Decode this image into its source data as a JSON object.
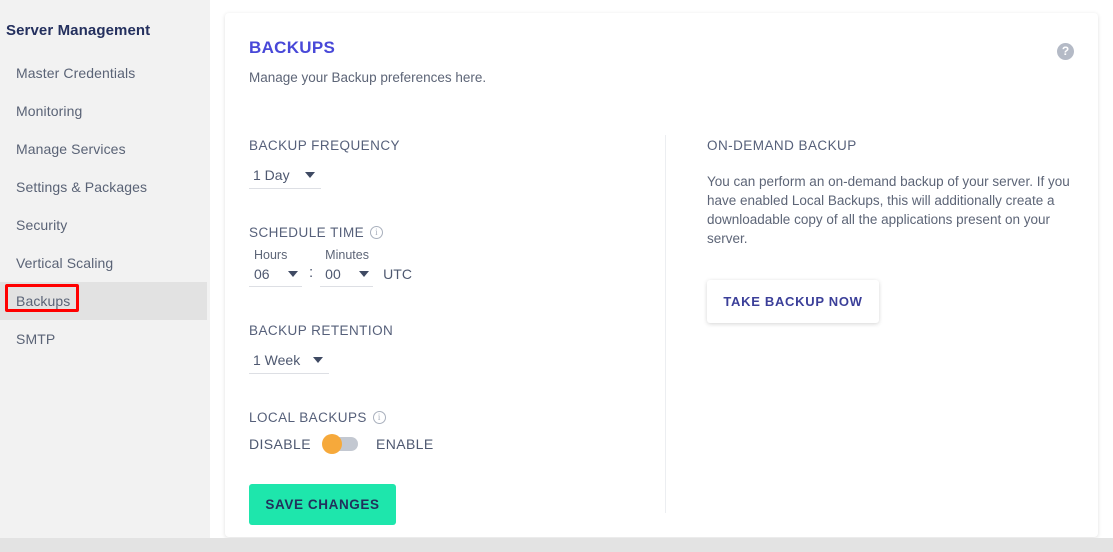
{
  "sidebar": {
    "heading": "Server Management",
    "items": [
      {
        "label": "Master Credentials",
        "active": false
      },
      {
        "label": "Monitoring",
        "active": false
      },
      {
        "label": "Manage Services",
        "active": false
      },
      {
        "label": "Settings & Packages",
        "active": false
      },
      {
        "label": "Security",
        "active": false
      },
      {
        "label": "Vertical Scaling",
        "active": false
      },
      {
        "label": "Backups",
        "active": true
      },
      {
        "label": "SMTP",
        "active": false
      }
    ],
    "annotation_color": "#ff0000",
    "active_item_background": "#e2e2e2"
  },
  "card": {
    "title": "BACKUPS",
    "subtitle": "Manage your Backup preferences here.",
    "title_color": "#4848d8",
    "help_icon": "help-question-icon"
  },
  "left_column": {
    "backup_frequency": {
      "label": "BACKUP FREQUENCY",
      "value": "1 Day"
    },
    "schedule_time": {
      "label": "SCHEDULE TIME",
      "info_icon": "info-icon",
      "hours_label": "Hours",
      "hours_value": "06",
      "separator": ":",
      "minutes_label": "Minutes",
      "minutes_value": "00",
      "timezone": "UTC"
    },
    "backup_retention": {
      "label": "BACKUP RETENTION",
      "value": "1 Week"
    },
    "local_backups": {
      "label": "LOCAL BACKUPS",
      "info_icon": "info-icon",
      "off_label": "DISABLE",
      "on_label": "ENABLE",
      "state": "disabled",
      "knob_color": "#f6a93b",
      "track_color": "#c3c8d1"
    },
    "save_button": {
      "label": "SAVE CHANGES",
      "background": "#1ee6ac",
      "text_color": "#22305c"
    }
  },
  "right_column": {
    "title": "ON-DEMAND BACKUP",
    "description": "You can perform an on-demand backup of your server. If you have enabled Local Backups, this will additionally create a downloadable copy of all the applications present on your server.",
    "take_backup_button": {
      "label": "TAKE BACKUP NOW",
      "text_color": "#3b3f99"
    }
  }
}
